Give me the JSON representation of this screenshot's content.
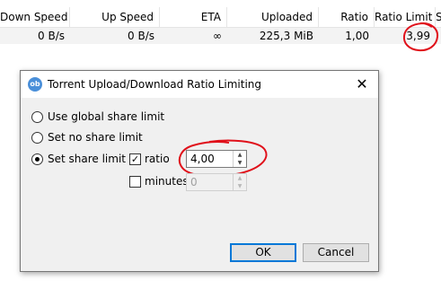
{
  "table": {
    "columns": [
      "Down Speed",
      "Up Speed",
      "ETA",
      "Uploaded",
      "Ratio",
      "Ratio Limit",
      "S"
    ],
    "row": [
      "0 B/s",
      "0 B/s",
      "∞",
      "225,3 MiB",
      "1,00",
      "3,99",
      ""
    ]
  },
  "dialog": {
    "title": "Torrent Upload/Download Ratio Limiting",
    "app_icon_text": "ob",
    "close_glyph": "✕",
    "options": {
      "global": "Use global share limit",
      "no_limit": "Set no share limit",
      "set_limit": "Set share limit to"
    },
    "selected_option": "set_limit",
    "ratio": {
      "label": "ratio",
      "checked": true,
      "value": "4,00"
    },
    "minutes": {
      "label": "minutes",
      "checked": false,
      "value": "0"
    },
    "buttons": {
      "ok": "OK",
      "cancel": "Cancel"
    }
  },
  "annotations": {
    "color": "#e0101a"
  },
  "colors": {
    "accent": "#0078d7"
  }
}
